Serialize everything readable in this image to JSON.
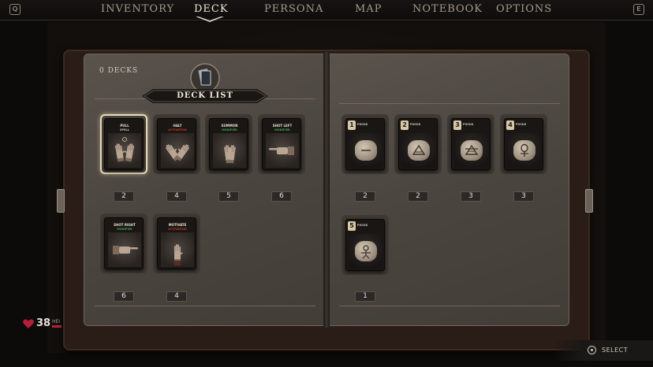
{
  "nav": {
    "left_key": "Q",
    "right_key": "E",
    "tabs": [
      {
        "label": "INVENTORY",
        "active": false
      },
      {
        "label": "DECK",
        "active": true
      },
      {
        "label": "PERSONA",
        "active": false
      },
      {
        "label": "MAP",
        "active": false
      },
      {
        "label": "NOTEBOOK",
        "active": false
      },
      {
        "label": "OPTIONS",
        "active": false
      }
    ]
  },
  "deck": {
    "count_label": "0 DECKS",
    "title": "DECK LIST"
  },
  "left_cards": [
    {
      "name": "PULL",
      "sub": "SPELL",
      "sub_color": "#cfc8bc",
      "count": "2",
      "selected": true,
      "art": "open-hands"
    },
    {
      "name": "HALT",
      "sub": "ACTIVATION",
      "sub_color": "#c0392b",
      "count": "4",
      "selected": false,
      "art": "raised-hands"
    },
    {
      "name": "SUMMON",
      "sub": "MODIFIER",
      "sub_color": "#3fa35a",
      "count": "5",
      "selected": false,
      "art": "praying-hands"
    },
    {
      "name": "SHOT LEFT",
      "sub": "MODIFIER",
      "sub_color": "#3fa35a",
      "count": "6",
      "selected": false,
      "art": "pointing-left"
    },
    {
      "name": "SHOT RIGHT",
      "sub": "MODIFIER",
      "sub_color": "#3fa35a",
      "count": "6",
      "selected": false,
      "art": "pointing-right"
    },
    {
      "name": "MOTIVATE",
      "sub": "ACTIVATION",
      "sub_color": "#c0392b",
      "count": "4",
      "selected": false,
      "art": "fingers-up"
    }
  ],
  "right_glyphs": [
    {
      "number": "1",
      "label": "FOCUS",
      "count": "2",
      "glyph": "dash"
    },
    {
      "number": "2",
      "label": "FOCUS",
      "count": "2",
      "glyph": "triangle"
    },
    {
      "number": "3",
      "label": "FOCUS",
      "count": "3",
      "glyph": "crossed-triangle"
    },
    {
      "number": "4",
      "label": "FOCUS",
      "count": "3",
      "glyph": "ankh"
    },
    {
      "number": "5",
      "label": "FOCUS",
      "count": "1",
      "glyph": "figure"
    }
  ],
  "hud": {
    "health_value": "38",
    "health_label": "HEI",
    "health_icon": "heart-icon",
    "health_color": "#b3203a"
  },
  "hint": {
    "button_icon": "gamepad-button-icon",
    "label": "SELECT"
  }
}
